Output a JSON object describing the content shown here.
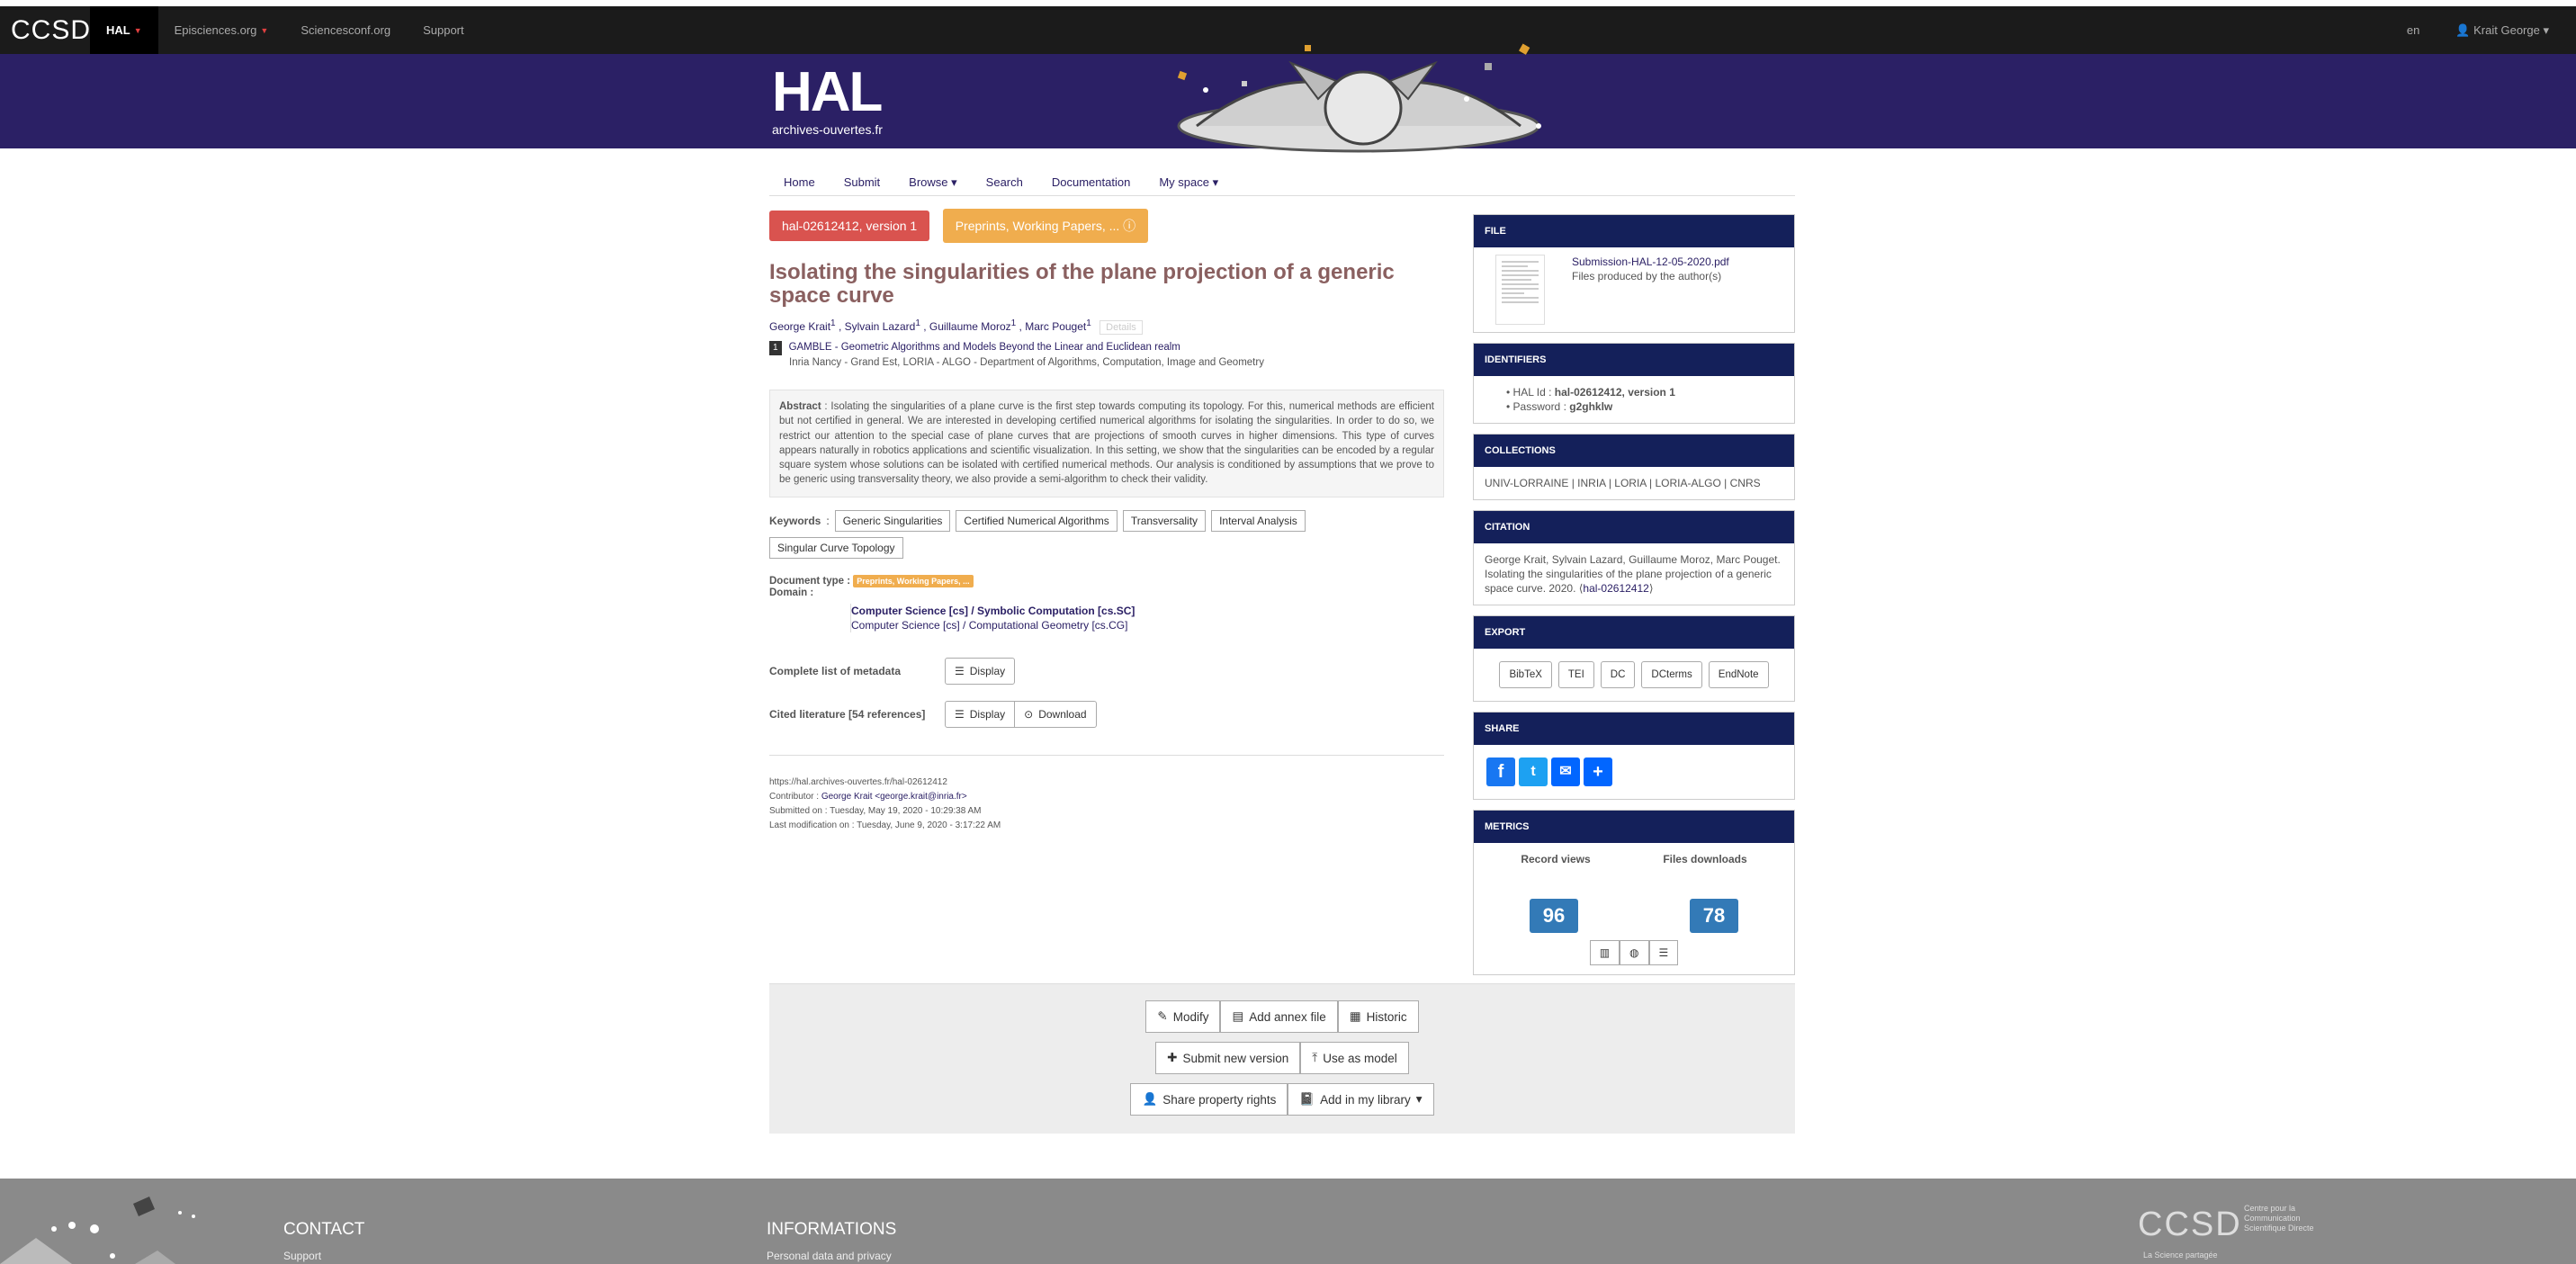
{
  "topbar": {
    "brand": "CCSD",
    "nav": [
      "HAL",
      "Episciences.org",
      "Sciencesconf.org",
      "Support"
    ],
    "lang": "en",
    "user": "Krait George"
  },
  "banner": {
    "logo_hal": "HAL",
    "logo_sub": "archives-ouvertes.fr"
  },
  "subnav": [
    "Home",
    "Submit",
    "Browse",
    "Search",
    "Documentation",
    "My space"
  ],
  "document": {
    "version_tag": "hal-02612412, version 1",
    "type_tag": "Preprints, Working Papers, ...",
    "title": "Isolating the singularities of the plane projection of a generic space curve",
    "authors": [
      "George Krait",
      "Sylvain Lazard",
      "Guillaume Moroz",
      "Marc Pouget"
    ],
    "author_sup": "1",
    "details_label": "Details",
    "affiliation_num": "1",
    "affiliation": "GAMBLE - Geometric Algorithms and Models Beyond the Linear and Euclidean realm",
    "affiliation_sub": "Inria Nancy - Grand Est, LORIA - ALGO - Department of Algorithms, Computation, Image and Geometry",
    "abstract_label": "Abstract",
    "abstract": "Isolating the singularities of a plane curve is the first step towards computing its topology. For this, numerical methods are efficient but not certified in general. We are interested in developing certified numerical algorithms for isolating the singularities. In order to do so, we restrict our attention to the special case of plane curves that are projections of smooth curves in higher dimensions. This type of curves appears naturally in robotics applications and scientific visualization. In this setting, we show that the singularities can be encoded by a regular square system whose solutions can be isolated with certified numerical methods. Our analysis is conditioned by assumptions that we prove to be generic using transversality theory, we also provide a semi-algorithm to check their validity.",
    "keywords_label": "Keywords",
    "keywords": [
      "Generic Singularities",
      "Certified Numerical Algorithms",
      "Transversality",
      "Interval Analysis",
      "Singular Curve Topology"
    ],
    "doctype_label": "Document type :",
    "doctype_badge": "Preprints, Working Papers, ...",
    "domain_label": "Domain :",
    "domain_primary": "Computer Science [cs] / Symbolic Computation [cs.SC]",
    "domain_secondary": "Computer Science [cs] / Computational Geometry [cs.CG]",
    "metadata_label": "Complete list of metadata",
    "cited_label": "Cited literature [54 references]",
    "display_label": "Display",
    "download_label": "Download",
    "url": "https://hal.archives-ouvertes.fr/hal-02612412",
    "contributor_label": "Contributor : ",
    "contributor": "George Krait <george.krait@inria.fr>",
    "submitted": "Submitted on : Tuesday, May 19, 2020 - 10:29:38 AM",
    "modified": "Last modification on : Tuesday, June 9, 2020 - 3:17:22 AM"
  },
  "sidebar": {
    "file_header": "FILE",
    "file_name": "Submission-HAL-12-05-2020.pdf",
    "file_note": "Files produced by the author(s)",
    "identifiers_header": "IDENTIFIERS",
    "hal_id_label": "HAL Id : ",
    "hal_id": "hal-02612412, version 1",
    "password_label": "Password : ",
    "password": "g2ghklw",
    "collections_header": "COLLECTIONS",
    "collections": [
      "UNIV-LORRAINE",
      "INRIA",
      "LORIA",
      "LORIA-ALGO",
      "CNRS"
    ],
    "citation_header": "CITATION",
    "citation": "George Krait, Sylvain Lazard, Guillaume Moroz, Marc Pouget. Isolating the singularities of the plane projection of a generic space curve. 2020.",
    "citation_link": "hal-02612412",
    "export_header": "EXPORT",
    "exports": [
      "BibTeX",
      "TEI",
      "DC",
      "DCterms",
      "EndNote"
    ],
    "share_header": "SHARE",
    "metrics_header": "METRICS",
    "record_views_label": "Record views",
    "files_downloads_label": "Files downloads",
    "record_views": "96",
    "files_downloads": "78"
  },
  "actions": {
    "modify": "Modify",
    "add_annex": "Add annex file",
    "historic": "Historic",
    "submit_new": "Submit new version",
    "use_model": "Use as model",
    "share_rights": "Share property rights",
    "add_library": "Add in my library"
  },
  "footer": {
    "contact": "CONTACT",
    "contact_link": "Support",
    "info": "INFORMATIONS",
    "info_link": "Personal data and privacy",
    "ccsd": "CCSD",
    "ccsd_tag": "Centre pour la Communication Scientifique Directe",
    "ccsd_slogan": "La Science partagée"
  }
}
